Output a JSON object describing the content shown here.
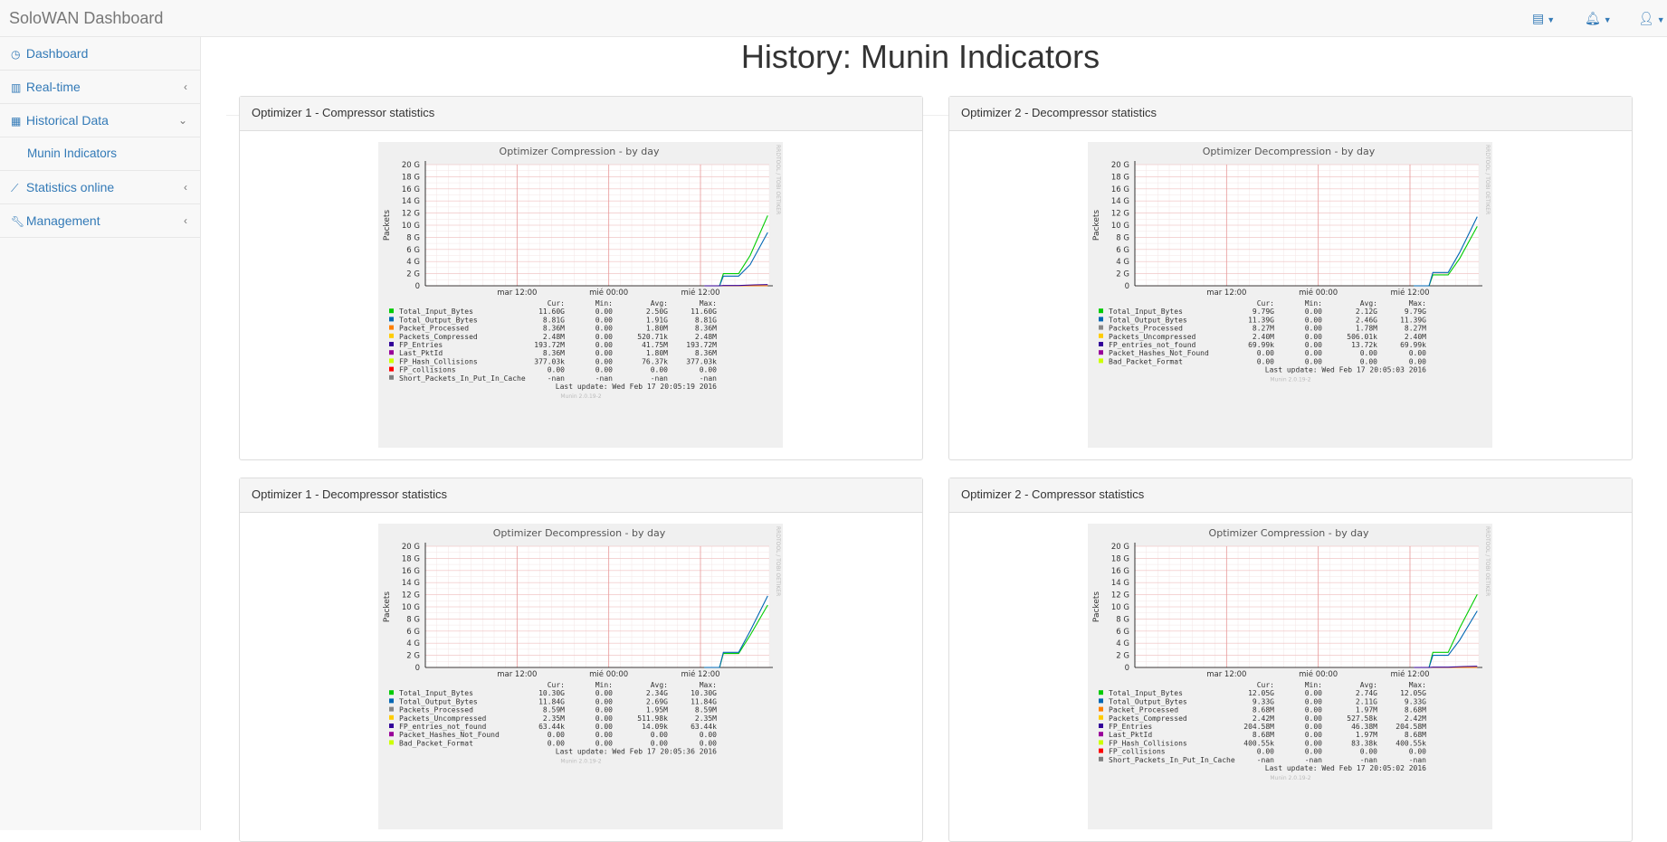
{
  "app": {
    "brand": "SoloWAN Dashboard",
    "top_icons": [
      "table-icon",
      "bell-icon",
      "user-icon"
    ]
  },
  "sidebar": {
    "items": [
      {
        "label": "Dashboard",
        "icon": "dashboard-icon"
      },
      {
        "label": "Real-time",
        "icon": "bar-chart-icon",
        "arrow": "‹"
      },
      {
        "label": "Historical Data",
        "icon": "table-icon",
        "arrow": "⌄"
      },
      {
        "label": "Munin Indicators"
      },
      {
        "label": "Statistics online",
        "icon": "line-chart-icon",
        "arrow": "‹"
      },
      {
        "label": "Management",
        "icon": "wrench-icon",
        "arrow": "‹"
      }
    ]
  },
  "page": {
    "title": "History: Munin Indicators"
  },
  "colors": {
    "Total_Input_Bytes": "#00cc00",
    "Total_Output_Bytes": "#0066b3",
    "Packet_Processed": "#ff8000",
    "Packets_Compressed": "#ffcc00",
    "Packets_Uncompressed": "#ffcc00",
    "FP_Entries": "#330099",
    "FP_entries_not_found": "#330099",
    "Last_PktId": "#990099",
    "Packet_Hashes_Not_Found": "#990099",
    "FP_Hash_Collisions": "#ccff00",
    "Bad_Packet_Format": "#ccff00",
    "FP_collisions": "#ff0000",
    "Short_Packets_In_Put_In_Cache": "#808080"
  },
  "panels": [
    {
      "heading": "Optimizer 1 - Compressor statistics",
      "chart_data": {
        "type": "line",
        "title": "Optimizer Compression - by day",
        "ylabel": "Packets",
        "side_label": "RRDTOOL / TOBI OETIKER",
        "y_ticks": [
          "0",
          "2 G",
          "4 G",
          "6 G",
          "8 G",
          "10 G",
          "12 G",
          "14 G",
          "16 G",
          "18 G",
          "20 G"
        ],
        "ylim": [
          0,
          20
        ],
        "x_ticks": [
          "mar 12:00",
          "mié 00:00",
          "mié 12:00"
        ],
        "x_tick_hours": [
          12,
          24,
          36
        ],
        "xlim": [
          0,
          45
        ],
        "grid": true,
        "headers": [
          "Cur:",
          "Min:",
          "Avg:",
          "Max:"
        ],
        "series": [
          {
            "name": "Total_Input_Bytes",
            "cur": "11.60G",
            "min": "0.00",
            "avg": "2.50G",
            "max": "11.60G",
            "points": [
              [
                36.5,
                0
              ],
              [
                38.5,
                0
              ],
              [
                39,
                2
              ],
              [
                41,
                2
              ],
              [
                42.5,
                5
              ],
              [
                44.8,
                11.6
              ]
            ]
          },
          {
            "name": "Total_Output_Bytes",
            "cur": "8.81G",
            "min": "0.00",
            "avg": "1.91G",
            "max": "8.81G",
            "points": [
              [
                36.5,
                0
              ],
              [
                38.5,
                0
              ],
              [
                39,
                1.6
              ],
              [
                41,
                1.6
              ],
              [
                42.5,
                3.5
              ],
              [
                44.8,
                8.8
              ]
            ]
          },
          {
            "name": "Packet_Processed",
            "cur": "8.36M",
            "min": "0.00",
            "avg": "1.80M",
            "max": "8.36M",
            "points": [
              [
                36.5,
                0
              ],
              [
                44.8,
                0.01
              ]
            ]
          },
          {
            "name": "Packets_Compressed",
            "cur": "2.48M",
            "min": "0.00",
            "avg": "520.71k",
            "max": "2.48M"
          },
          {
            "name": "FP_Entries",
            "cur": "193.72M",
            "min": "0.00",
            "avg": "41.75M",
            "max": "193.72M",
            "points": [
              [
                36.5,
                0
              ],
              [
                38.5,
                0
              ],
              [
                39,
                0.05
              ],
              [
                41,
                0.05
              ],
              [
                43,
                0.15
              ],
              [
                44.8,
                0.2
              ]
            ]
          },
          {
            "name": "Last_PktId",
            "cur": "8.36M",
            "min": "0.00",
            "avg": "1.80M",
            "max": "8.36M"
          },
          {
            "name": "FP_Hash_Collisions",
            "cur": "377.03k",
            "min": "0.00",
            "avg": "76.37k",
            "max": "377.03k"
          },
          {
            "name": "FP_collisions",
            "cur": "0.00",
            "min": "0.00",
            "avg": "0.00",
            "max": "0.00"
          },
          {
            "name": "Short_Packets_In_Put_In_Cache",
            "cur": "-nan",
            "min": "-nan",
            "avg": "-nan",
            "max": "-nan"
          }
        ],
        "last_update": "Last update: Wed Feb 17 20:05:19 2016",
        "footer": "Munin 2.0.19-2"
      }
    },
    {
      "heading": "Optimizer 2 - Decompressor statistics",
      "chart_data": {
        "type": "line",
        "title": "Optimizer Decompression - by day",
        "ylabel": "Packets",
        "side_label": "RRDTOOL / TOBI OETIKER",
        "y_ticks": [
          "0",
          "2 G",
          "4 G",
          "6 G",
          "8 G",
          "10 G",
          "12 G",
          "14 G",
          "16 G",
          "18 G",
          "20 G"
        ],
        "ylim": [
          0,
          20
        ],
        "x_ticks": [
          "mar 12:00",
          "mié 00:00",
          "mié 12:00"
        ],
        "x_tick_hours": [
          12,
          24,
          36
        ],
        "xlim": [
          0,
          45
        ],
        "grid": true,
        "headers": [
          "Cur:",
          "Min:",
          "Avg:",
          "Max:"
        ],
        "series": [
          {
            "name": "Total_Input_Bytes",
            "cur": "9.79G",
            "min": "0.00",
            "avg": "2.12G",
            "max": "9.79G",
            "points": [
              [
                36.5,
                0
              ],
              [
                38.5,
                0
              ],
              [
                39,
                1.8
              ],
              [
                41,
                1.8
              ],
              [
                42.5,
                4.5
              ],
              [
                44.8,
                9.8
              ]
            ]
          },
          {
            "name": "Total_Output_Bytes",
            "cur": "11.39G",
            "min": "0.00",
            "avg": "2.46G",
            "max": "11.39G",
            "points": [
              [
                36.5,
                0
              ],
              [
                38.5,
                0
              ],
              [
                39,
                2.2
              ],
              [
                41,
                2.2
              ],
              [
                42.5,
                5.5
              ],
              [
                44.8,
                11.4
              ]
            ]
          },
          {
            "name": "Packets_Processed",
            "cur": "8.27M",
            "min": "0.00",
            "avg": "1.78M",
            "max": "8.27M"
          },
          {
            "name": "Packets_Uncompressed",
            "cur": "2.40M",
            "min": "0.00",
            "avg": "506.01k",
            "max": "2.40M"
          },
          {
            "name": "FP_entries_not_found",
            "cur": "69.99k",
            "min": "0.00",
            "avg": "13.72k",
            "max": "69.99k"
          },
          {
            "name": "Packet_Hashes_Not_Found",
            "cur": "0.00",
            "min": "0.00",
            "avg": "0.00",
            "max": "0.00"
          },
          {
            "name": "Bad_Packet_Format",
            "cur": "0.00",
            "min": "0.00",
            "avg": "0.00",
            "max": "0.00"
          }
        ],
        "last_update": "Last update: Wed Feb 17 20:05:03 2016",
        "footer": "Munin 2.0.19-2"
      }
    },
    {
      "heading": "Optimizer 1 - Decompressor statistics",
      "chart_data": {
        "type": "line",
        "title": "Optimizer Decompression - by day",
        "ylabel": "Packets",
        "side_label": "RRDTOOL / TOBI OETIKER",
        "y_ticks": [
          "0",
          "2 G",
          "4 G",
          "6 G",
          "8 G",
          "10 G",
          "12 G",
          "14 G",
          "16 G",
          "18 G",
          "20 G"
        ],
        "ylim": [
          0,
          20
        ],
        "x_ticks": [
          "mar 12:00",
          "mié 00:00",
          "mié 12:00"
        ],
        "x_tick_hours": [
          12,
          24,
          36
        ],
        "xlim": [
          0,
          45
        ],
        "grid": true,
        "headers": [
          "Cur:",
          "Min:",
          "Avg:",
          "Max:"
        ],
        "series": [
          {
            "name": "Total_Input_Bytes",
            "cur": "10.30G",
            "min": "0.00",
            "avg": "2.34G",
            "max": "10.30G",
            "points": [
              [
                36.5,
                0
              ],
              [
                38.5,
                0
              ],
              [
                39,
                2.3
              ],
              [
                41,
                2.3
              ],
              [
                42.5,
                5.3
              ],
              [
                44.8,
                10.3
              ]
            ]
          },
          {
            "name": "Total_Output_Bytes",
            "cur": "11.84G",
            "min": "0.00",
            "avg": "2.69G",
            "max": "11.84G",
            "points": [
              [
                36.5,
                0
              ],
              [
                38.5,
                0
              ],
              [
                39,
                2.5
              ],
              [
                41,
                2.5
              ],
              [
                42.5,
                6
              ],
              [
                44.8,
                11.8
              ]
            ]
          },
          {
            "name": "Packets_Processed",
            "cur": "8.59M",
            "min": "0.00",
            "avg": "1.95M",
            "max": "8.59M"
          },
          {
            "name": "Packets_Uncompressed",
            "cur": "2.35M",
            "min": "0.00",
            "avg": "511.98k",
            "max": "2.35M"
          },
          {
            "name": "FP_entries_not_found",
            "cur": "63.44k",
            "min": "0.00",
            "avg": "14.09k",
            "max": "63.44k"
          },
          {
            "name": "Packet_Hashes_Not_Found",
            "cur": "0.00",
            "min": "0.00",
            "avg": "0.00",
            "max": "0.00"
          },
          {
            "name": "Bad_Packet_Format",
            "cur": "0.00",
            "min": "0.00",
            "avg": "0.00",
            "max": "0.00"
          }
        ],
        "last_update": "Last update: Wed Feb 17 20:05:36 2016",
        "footer": "Munin 2.0.19-2"
      }
    },
    {
      "heading": "Optimizer 2 - Compressor statistics",
      "chart_data": {
        "type": "line",
        "title": "Optimizer Compression - by day",
        "ylabel": "Packets",
        "side_label": "RRDTOOL / TOBI OETIKER",
        "y_ticks": [
          "0",
          "2 G",
          "4 G",
          "6 G",
          "8 G",
          "10 G",
          "12 G",
          "14 G",
          "16 G",
          "18 G",
          "20 G"
        ],
        "ylim": [
          0,
          20
        ],
        "x_ticks": [
          "mar 12:00",
          "mié 00:00",
          "mié 12:00"
        ],
        "x_tick_hours": [
          12,
          24,
          36
        ],
        "xlim": [
          0,
          45
        ],
        "grid": true,
        "headers": [
          "Cur:",
          "Min:",
          "Avg:",
          "Max:"
        ],
        "series": [
          {
            "name": "Total_Input_Bytes",
            "cur": "12.05G",
            "min": "0.00",
            "avg": "2.74G",
            "max": "12.05G",
            "points": [
              [
                36.5,
                0
              ],
              [
                38.5,
                0
              ],
              [
                39,
                2.5
              ],
              [
                41,
                2.5
              ],
              [
                42.5,
                6.5
              ],
              [
                44.8,
                12.05
              ]
            ]
          },
          {
            "name": "Total_Output_Bytes",
            "cur": "9.33G",
            "min": "0.00",
            "avg": "2.11G",
            "max": "9.33G",
            "points": [
              [
                36.5,
                0
              ],
              [
                38.5,
                0
              ],
              [
                39,
                2
              ],
              [
                41,
                2
              ],
              [
                42.5,
                4.5
              ],
              [
                44.8,
                9.33
              ]
            ]
          },
          {
            "name": "Packet_Processed",
            "cur": "8.68M",
            "min": "0.00",
            "avg": "1.97M",
            "max": "8.68M",
            "points": [
              [
                36.5,
                0
              ],
              [
                44.8,
                0.01
              ]
            ]
          },
          {
            "name": "Packets_Compressed",
            "cur": "2.42M",
            "min": "0.00",
            "avg": "527.58k",
            "max": "2.42M"
          },
          {
            "name": "FP_Entries",
            "cur": "204.58M",
            "min": "0.00",
            "avg": "46.38M",
            "max": "204.58M",
            "points": [
              [
                36.5,
                0
              ],
              [
                38.5,
                0
              ],
              [
                39,
                0.05
              ],
              [
                41,
                0.05
              ],
              [
                43,
                0.15
              ],
              [
                44.8,
                0.2
              ]
            ]
          },
          {
            "name": "Last_PktId",
            "cur": "8.68M",
            "min": "0.00",
            "avg": "1.97M",
            "max": "8.68M"
          },
          {
            "name": "FP_Hash_Collisions",
            "cur": "400.55k",
            "min": "0.00",
            "avg": "83.38k",
            "max": "400.55k"
          },
          {
            "name": "FP_collisions",
            "cur": "0.00",
            "min": "0.00",
            "avg": "0.00",
            "max": "0.00"
          },
          {
            "name": "Short_Packets_In_Put_In_Cache",
            "cur": "-nan",
            "min": "-nan",
            "avg": "-nan",
            "max": "-nan"
          }
        ],
        "last_update": "Last update: Wed Feb 17 20:05:02 2016",
        "footer": "Munin 2.0.19-2"
      }
    }
  ]
}
